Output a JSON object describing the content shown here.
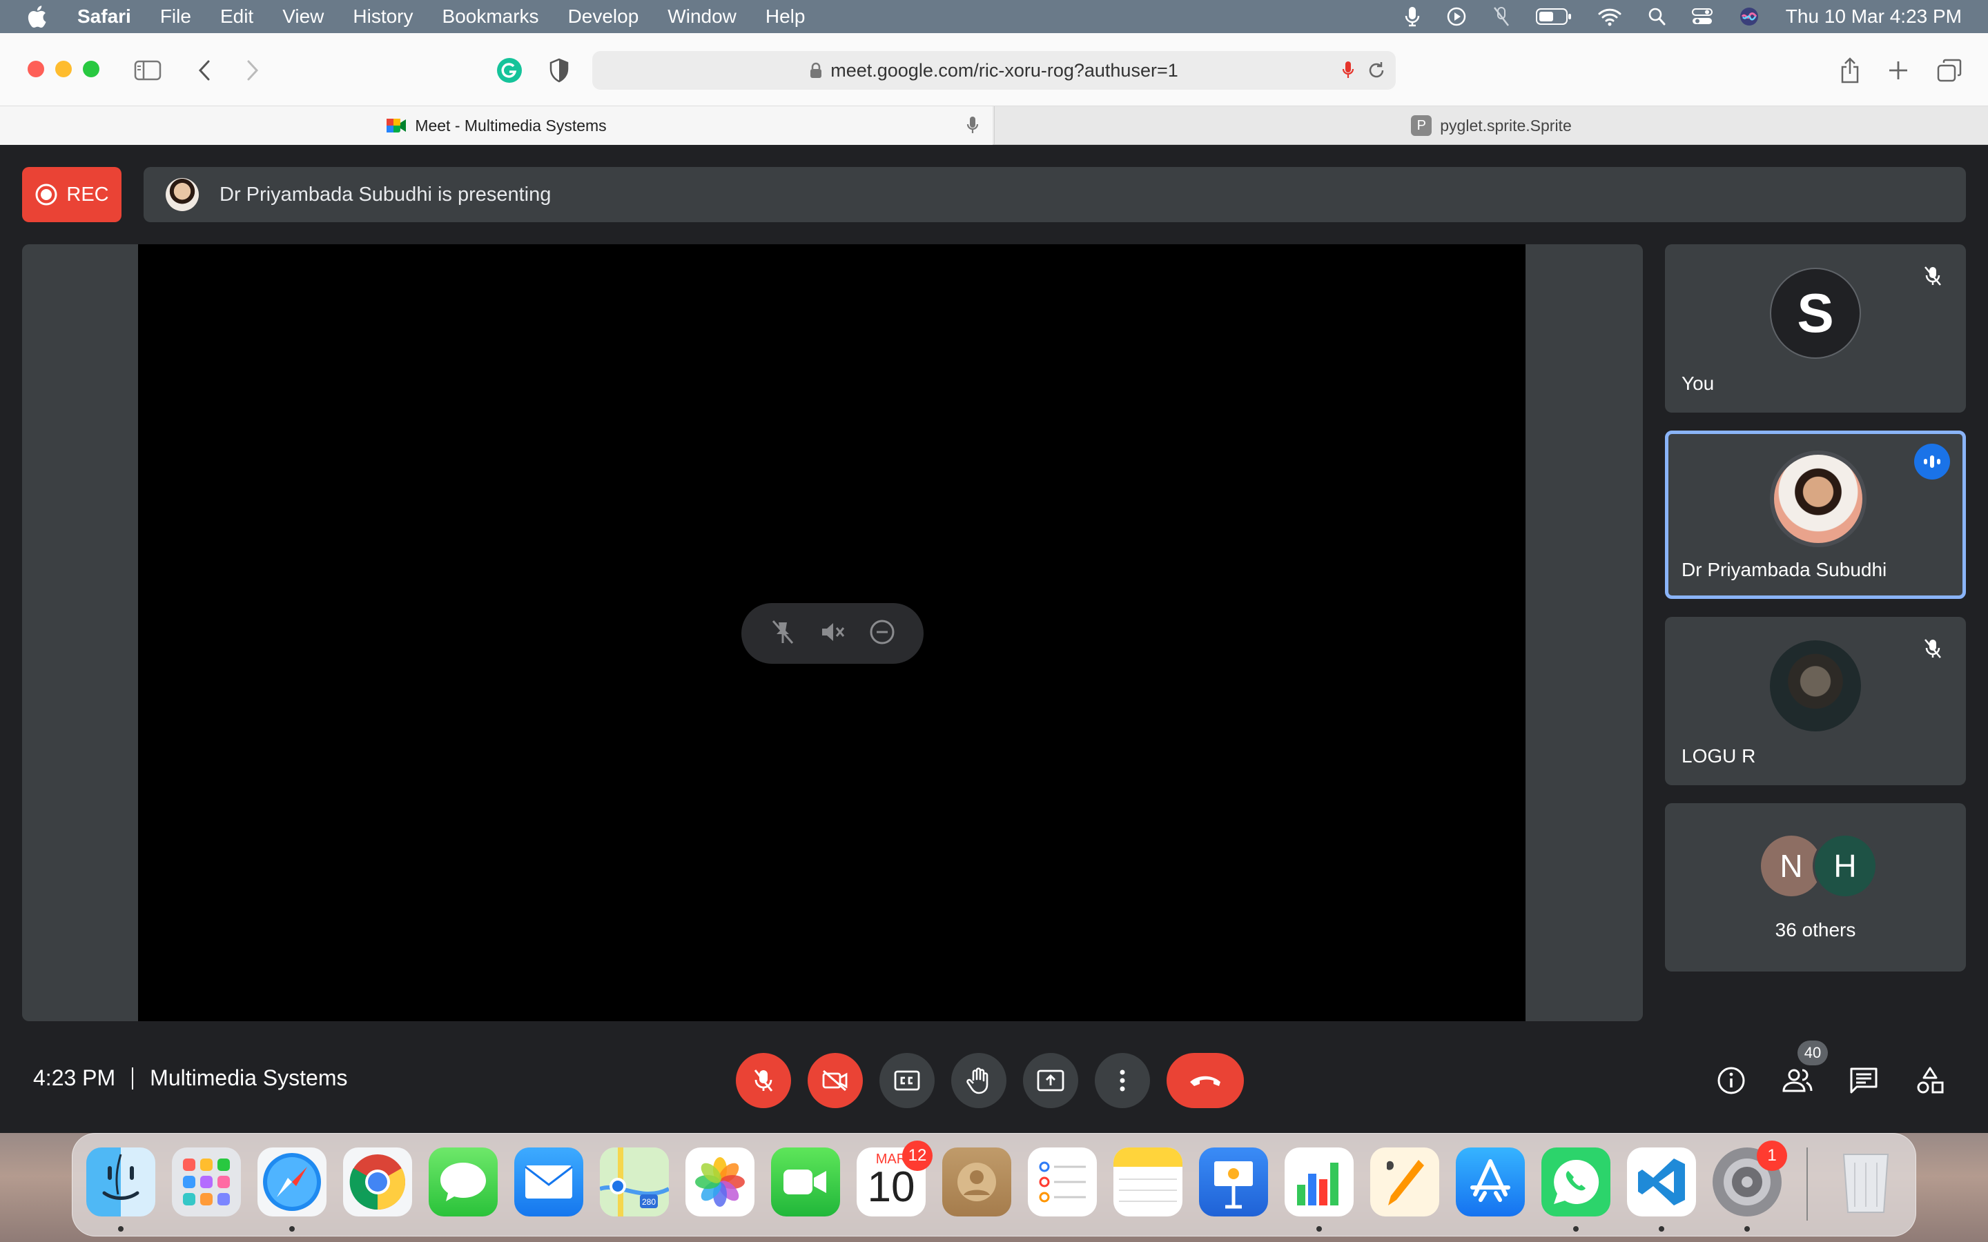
{
  "menubar": {
    "app": "Safari",
    "items": [
      "File",
      "Edit",
      "View",
      "History",
      "Bookmarks",
      "Develop",
      "Window",
      "Help"
    ],
    "clock": "Thu 10 Mar  4:23 PM"
  },
  "browser": {
    "url": "meet.google.com/ric-xoru-rog?authuser=1",
    "tabs": [
      {
        "label": "Meet - Multimedia Systems"
      },
      {
        "label": "pyglet.sprite.Sprite"
      }
    ]
  },
  "meet": {
    "rec_label": "REC",
    "presenting_text": "Dr Priyambada Subudhi is presenting",
    "participants": [
      {
        "name": "You",
        "initial": "S",
        "muted": true
      },
      {
        "name": "Dr Priyambada Subudhi",
        "speaking": true
      },
      {
        "name": "LOGU R",
        "muted": true
      }
    ],
    "others": {
      "initials": [
        "N",
        "H"
      ],
      "label": "36 others"
    },
    "time": "4:23 PM",
    "meeting_name": "Multimedia Systems",
    "people_count": "40"
  },
  "dock": {
    "calendar_month": "MAR",
    "calendar_day": "10",
    "calendar_badge": "12",
    "settings_badge": "1",
    "maps_label": "280"
  },
  "colors": {
    "meet_bg": "#202124",
    "tile_bg": "#3c4043",
    "red": "#ea4335",
    "speaking_border": "#8ab4f8"
  }
}
